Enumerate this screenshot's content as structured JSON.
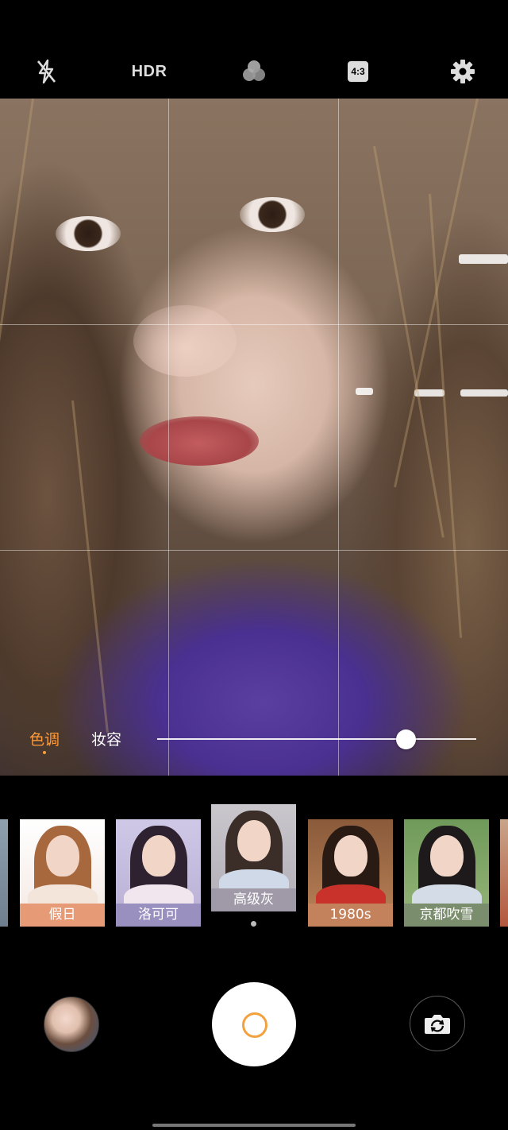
{
  "topbar": {
    "flash_icon": "flash-off-icon",
    "hdr_label": "HDR",
    "filter_icon": "color-filter-icon",
    "ratio_label": "4:3",
    "settings_icon": "gear-icon"
  },
  "adjust": {
    "tabs": [
      {
        "label": "色调",
        "active": true
      },
      {
        "label": "妆容",
        "active": false
      }
    ],
    "slider_level": 0.78,
    "accent_color": "#ff9b3c"
  },
  "filters": [
    {
      "label": "假日",
      "color": "#e79a76"
    },
    {
      "label": "洛可可",
      "color": "#9a90bf"
    },
    {
      "label": "高级灰",
      "color": "#9f99a8",
      "selected": true
    },
    {
      "label": "1980s",
      "color": "#c4825c"
    },
    {
      "label": "京都吹雪",
      "color": "#7a8d6c"
    }
  ],
  "controls": {
    "gallery_icon": "gallery-thumbnail",
    "shutter_accent": "#f2a13e",
    "switch_camera_icon": "switch-camera-icon"
  }
}
